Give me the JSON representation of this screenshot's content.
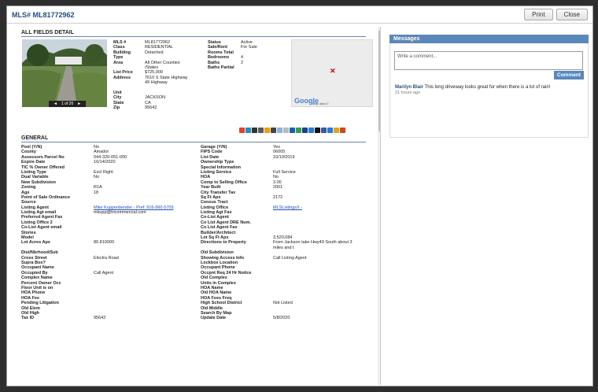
{
  "modal": {
    "title": "MLS# ML81772962",
    "print_label": "Print",
    "close_label": "Close"
  },
  "detail": {
    "section_title": "ALL FIELDS DETAIL",
    "photo_counter": "1 of 26",
    "summary_left": [
      {
        "label": "MLS #",
        "value": "ML81772962"
      },
      {
        "label": "Class",
        "value": "RESIDENTIAL"
      },
      {
        "label": "Building",
        "value": "Detached"
      },
      {
        "label": "Type",
        "value": ""
      },
      {
        "label": "Area",
        "value": "All Other Counties"
      },
      {
        "label": "",
        "value": "/States"
      },
      {
        "label": "List Price",
        "value": "$725,000"
      },
      {
        "label": "Address",
        "value": "7610 S State Highway"
      },
      {
        "label": "",
        "value": "49 Highway"
      },
      {
        "label": "",
        "value": ""
      },
      {
        "label": "Unit",
        "value": ""
      },
      {
        "label": "City",
        "value": "JACKSON"
      },
      {
        "label": "State",
        "value": "CA"
      },
      {
        "label": "Zip",
        "value": "95642"
      }
    ],
    "summary_right": [
      {
        "label": "Status",
        "value": "Active"
      },
      {
        "label": "Sale/Rent",
        "value": "For Sale"
      },
      {
        "label": "Rooms Total",
        "value": ""
      },
      {
        "label": "Bedrooms",
        "value": "4"
      },
      {
        "label": "Baths",
        "value": "2"
      },
      {
        "label": "Baths Partial",
        "value": ""
      }
    ],
    "map_logo": "Google",
    "map_data_label": "Map data ©"
  },
  "general": {
    "section_title": "GENERAL",
    "rows": [
      [
        "Pool (Y/N)",
        "No",
        "Garage (Y/N)",
        "Yes"
      ],
      [
        "County",
        "Amador",
        "FIPS Code",
        "06005"
      ],
      [
        "Assessors Parcel No",
        "044-320-051-000",
        "List Date",
        "10/10/2019"
      ],
      [
        "Expire Date",
        "10/14/2020",
        "Ownership Type",
        ""
      ],
      [
        "TIC % Owner Offered",
        "",
        "Special Information",
        ""
      ],
      [
        "Listing Type",
        "Excl Right",
        "Listing Service",
        "Full Service"
      ],
      [
        "Dual Variable",
        "No",
        "HOA",
        "No"
      ],
      [
        "New Subdivision",
        "",
        "Comp to Selling Office",
        "3.00"
      ],
      [
        "Zoning",
        "R1A",
        "Year Built",
        "2001"
      ],
      [
        "Age",
        "18",
        "City Transfer Tax",
        ""
      ],
      [
        "Point of Sale Ordinance",
        "",
        "Sq Ft Apx",
        "2172"
      ],
      [
        "Source",
        "",
        "Census Tract",
        ""
      ],
      [
        "Listing Agent",
        "Mike Kuppenbender - Pref: 916-960-5709",
        "Listing Office",
        "MLSListingsX -"
      ],
      [
        "Listing Agt email",
        "mkupp@tricommercial.com",
        "Listing Agt Fax",
        ""
      ],
      [
        "Preferred Agent Fax",
        "",
        "Co-List Agent",
        ""
      ],
      [
        "Listing Office 2",
        "",
        "Co List Agent DRE Num.",
        ""
      ],
      [
        "Co-List Agent email",
        "",
        "Co List Agent Fax",
        ""
      ],
      [
        "Stories",
        "",
        "Builder/Architect",
        ""
      ],
      [
        "Model",
        "",
        "Lot Sq Ft Apx",
        "3,520,084"
      ],
      [
        "Lot Acres Apx",
        "80.810000",
        "Directions to Property",
        "From Jackson take Hwy49 South about 3"
      ],
      [
        "",
        "",
        "",
        "miles and t"
      ],
      [
        "Dist/Nbrhood/Sub",
        "",
        "Old Subdivision",
        ""
      ],
      [
        "Cross Street",
        "Electra Road",
        "Showing Access Info",
        "Call Listing Agent"
      ],
      [
        "Supra Box?",
        "",
        "Lockbox Location",
        ""
      ],
      [
        "Occupant Name",
        "",
        "Occupant Phone",
        ""
      ],
      [
        "Occupied By",
        "Call Agent",
        "Occpnt Req 24 Hr Notice",
        ""
      ],
      [
        "Complex Name",
        "",
        "Old Complex",
        ""
      ],
      [
        "Percent Owner Occ",
        "",
        "Units in Complex",
        ""
      ],
      [
        "Floor Unit is on",
        "",
        "HOA Name",
        ""
      ],
      [
        "HOA Phone",
        "",
        "Old HOA Name",
        ""
      ],
      [
        "HOA Fee",
        "",
        "HOA Fees Freq",
        ""
      ],
      [
        "Pending Litigation",
        "",
        "High School District",
        "Not Listed"
      ],
      [
        "Old Elem",
        "",
        "Old Middle",
        ""
      ],
      [
        "Old High",
        "",
        "Search By Map",
        ""
      ],
      [
        "Tax ID",
        "95642",
        "Update Date",
        "5/8/2020"
      ]
    ]
  },
  "messages": {
    "header": "Messages",
    "input_placeholder": "Write a comment...",
    "comment_button": "Comment",
    "items": [
      {
        "author": "Marilyn Blair",
        "text": "This long driveway looks great for when there is a lot of rain!",
        "ago": "21 hours ago"
      }
    ]
  }
}
